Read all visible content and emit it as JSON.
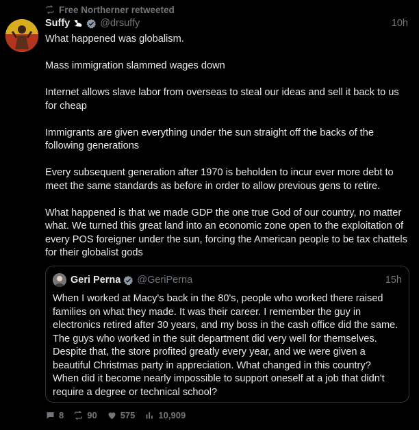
{
  "retweet": {
    "label": "Free Northerner retweeted",
    "icon": "retweet-icon"
  },
  "tweet": {
    "name": "Suffy",
    "handle": "@drsuffy",
    "time": "10h",
    "paragraphs": [
      "What happened was globalism.",
      "Mass immigration slammed wages down",
      "Internet allows slave labor from overseas to steal our ideas and sell it back to us for cheap",
      "Immigrants are given everything under the sun straight off the backs of the following generations",
      "Every subsequent generation after 1970 is beholden to incur ever more debt to meet the same standards as before in order to allow previous gens to retire.",
      "What happened is that we made GDP the one true God of our country, no matter what. We turned this great land into an economic zone open to the exploitation of every POS foreigner under the sun, forcing the American people to be tax chattels for their globalist gods"
    ]
  },
  "quote": {
    "name": "Geri Perna",
    "handle": "@GeriPerna",
    "time": "15h",
    "text": "When I worked at Macy's back in the 80's, people who worked there raised families on what they made. It was their career. I remember the guy in electronics retired after 30 years, and my boss in the cash office did the same. The guys who worked in the suit department did very well for themselves. Despite that, the store profited greatly every year, and we were given a beautiful Christmas party in appreciation.  What changed in this country? When did it become nearly impossible to support oneself at a job that didn't require a degree or technical school?"
  },
  "actions": {
    "replies": "8",
    "retweets": "90",
    "likes": "575",
    "views": "10,909"
  },
  "colors": {
    "background": "#000000",
    "text": "#e7e9ea",
    "muted": "#71767b",
    "verified": "#1d9bf0",
    "border": "#333639"
  }
}
